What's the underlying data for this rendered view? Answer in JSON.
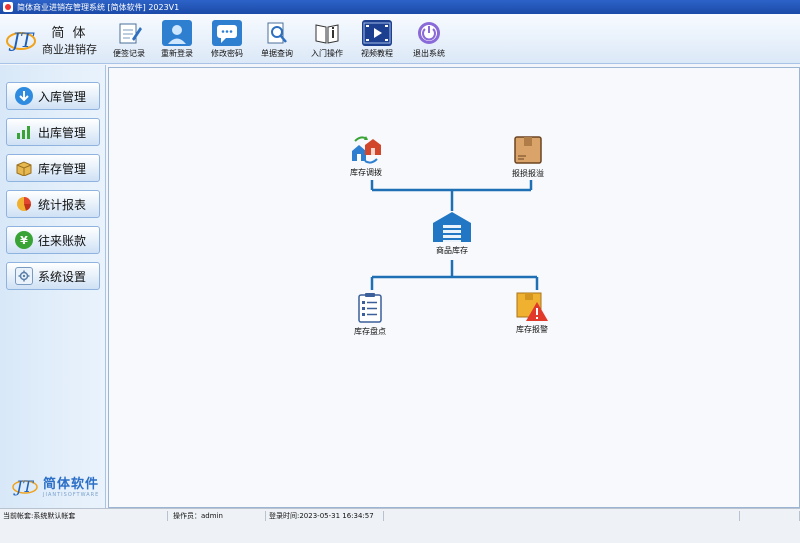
{
  "window": {
    "title": "简体商业进销存管理系统 [简体软件] 2023V1"
  },
  "brand": {
    "line1": "简 体",
    "line2": "商业进销存",
    "footer_name": "简体软件",
    "footer_sub": "JIANTISOFTWARE"
  },
  "toolbar": {
    "buttons": [
      {
        "label": "便签记录",
        "icon": "notepad-icon"
      },
      {
        "label": "重新登录",
        "icon": "user-icon"
      },
      {
        "label": "修改密码",
        "icon": "chat-bubble-icon"
      },
      {
        "label": "单据查询",
        "icon": "search-doc-icon"
      },
      {
        "label": "入门操作",
        "icon": "info-book-icon"
      },
      {
        "label": "视频教程",
        "icon": "video-icon"
      },
      {
        "label": "退出系统",
        "icon": "power-icon"
      }
    ]
  },
  "sidebar": {
    "items": [
      {
        "label": "入库管理",
        "icon": "arrow-down-icon",
        "color": "#2f8be0"
      },
      {
        "label": "出库管理",
        "icon": "bar-chart-icon",
        "color": "#3aa335"
      },
      {
        "label": "库存管理",
        "icon": "box-icon",
        "color": "#d9a13b"
      },
      {
        "label": "统计报表",
        "icon": "pie-chart-icon",
        "color": "#e2462f"
      },
      {
        "label": "往来账款",
        "icon": "yen-icon",
        "color": "#3aa335"
      },
      {
        "label": "系统设置",
        "icon": "gear-icon",
        "color": "#7a9bbf"
      }
    ]
  },
  "diagram": {
    "center": {
      "label": "商品库存",
      "icon": "warehouse-icon"
    },
    "top_left": {
      "label": "库存调拨",
      "icon": "transfer-houses-icon"
    },
    "top_right": {
      "label": "报损报溢",
      "icon": "damaged-box-icon"
    },
    "bottom_left": {
      "label": "库存盘点",
      "icon": "checklist-icon"
    },
    "bottom_right": {
      "label": "库存报警",
      "icon": "warning-box-icon"
    }
  },
  "status": {
    "account": "当前帐套:系统默认帐套",
    "operator": "操作员：admin",
    "login_time": "登录时间:2023-05-31 16:34:57"
  },
  "colors": {
    "accent": "#2b7bc7",
    "line": "#1f6fb5"
  }
}
